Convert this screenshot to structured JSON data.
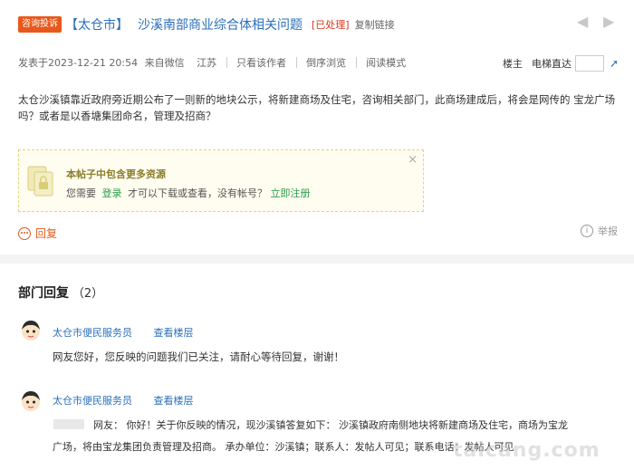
{
  "header": {
    "badge": "咨询投诉",
    "city_tag": "【太仓市】",
    "title": "沙溪南部商业综合体相关问题",
    "status": "[已处理]",
    "copy_link": "复制链接"
  },
  "meta": {
    "posted": "发表于2023-12-21 20:54",
    "source": "来自微信",
    "region": "江苏",
    "only_author": "只看该作者",
    "reverse_browse": "倒序浏览",
    "read_mode": "阅读模式",
    "floor_owner": "楼主",
    "elevator": "电梯直达",
    "floor_input_value": ""
  },
  "post": {
    "content": "太仓沙溪镇靠近政府旁近期公布了一则新的地块公示，将新建商场及住宅，咨询相关部门，此商场建成后，将会是网传的 宝龙广场吗？或者是以香塘集团命名，管理及招商？"
  },
  "notice": {
    "title": "本帖子中包含更多资源",
    "text_prefix": "您需要",
    "login": "登录",
    "text_middle": "才可以下载或查看，没有帐号？",
    "register": "立即注册",
    "close": "×"
  },
  "actions": {
    "reply": "回复",
    "report": "举报"
  },
  "dept": {
    "heading": "部门回复",
    "count": "（2）",
    "replies": [
      {
        "name": "太仓市便民服务员",
        "view": "查看楼层",
        "text": "网友您好，您反映的问题我们已关注，请耐心等待回复，谢谢！"
      },
      {
        "name": "太仓市便民服务员",
        "view": "查看楼层",
        "text_line1": "网友：  你好！关于你反映的情况，现沙溪镇答复如下：  沙溪镇政府南侧地块将新建商场及住宅，商场为宝龙",
        "text_line2": "广场，将由宝龙集团负责管理及招商。  承办单位：沙溪镇；联系人：发帖人可见；联系电话：发帖人可见"
      }
    ]
  },
  "watermark": "taicang.com",
  "colors": {
    "accent": "#e8581a",
    "link": "#2b6fba",
    "status": "#d9371c"
  }
}
